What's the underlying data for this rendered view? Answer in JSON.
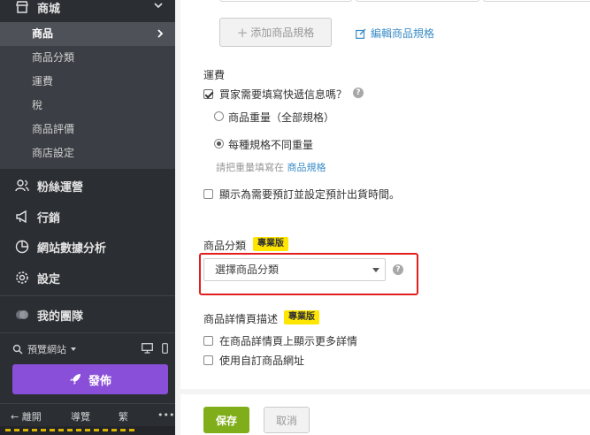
{
  "sidebar": {
    "store_label": "商城",
    "submenu": [
      {
        "label": "商品",
        "active": true
      },
      {
        "label": "商品分類"
      },
      {
        "label": "運費"
      },
      {
        "label": "稅"
      },
      {
        "label": "商品評價"
      },
      {
        "label": "商店設定"
      }
    ],
    "sections": [
      {
        "label": "粉絲運營",
        "icon": "users-icon"
      },
      {
        "label": "行銷",
        "icon": "megaphone-icon"
      },
      {
        "label": "網站數據分析",
        "icon": "pie-chart-icon"
      },
      {
        "label": "設定",
        "icon": "gear-icon"
      }
    ],
    "my_team": "我的團隊",
    "preview_site": "預覽網站",
    "publish": "發佈",
    "bottom": {
      "leave": "← 離開",
      "guide": "導覽",
      "traditional": "繁",
      "more": "•••"
    }
  },
  "main": {
    "add_spec": "添加商品規格",
    "edit_spec": "編輯商品規格",
    "shipping": {
      "title": "運費",
      "buyer_fill_checkbox": "買家需要填寫快遞信息嗎？",
      "buyer_fill_checked": true,
      "radio_product_weight": "商品重量（全部規格）",
      "radio_per_spec_weight": "每種規格不同重量",
      "selected_radio": "per_spec_weight",
      "hint_prefix": "請把重量填寫在",
      "hint_link": "商品規格",
      "preorder_checkbox": "顯示為需要預訂並設定預計出貨時間。"
    },
    "category": {
      "title": "商品分類",
      "badge": "專業版",
      "select_value": "選擇商品分類"
    },
    "detail_page": {
      "title": "商品詳情頁描述",
      "badge": "專業版",
      "show_more_checkbox": "在商品詳情頁上顯示更多詳情",
      "custom_url_checkbox": "使用自訂商品網址"
    },
    "save": "保存",
    "cancel": "取消"
  },
  "colors": {
    "sidebar_bg": "#2b2e33",
    "publish_purple": "#8a4fd8",
    "save_green": "#7fae1a",
    "pro_badge_yellow": "#ffe600",
    "link_blue": "#3b8dc7",
    "highlight_red": "#e21e1e"
  }
}
